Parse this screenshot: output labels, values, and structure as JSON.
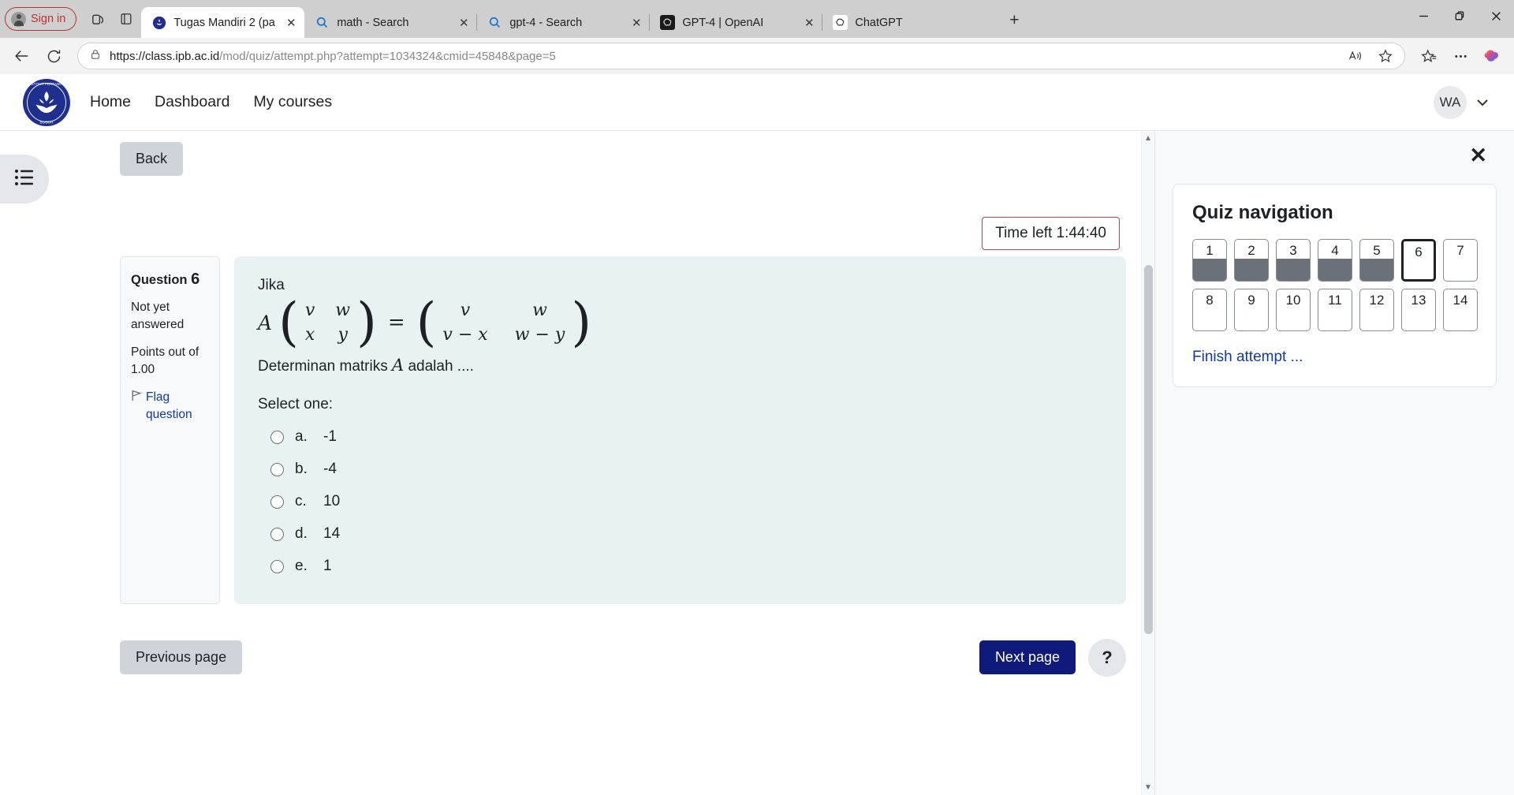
{
  "browser": {
    "signin_label": "Sign in",
    "tabs": [
      {
        "title": "Tugas Mandiri 2 (page",
        "favicon": "ipb-icon",
        "active": true,
        "closable": true
      },
      {
        "title": "math - Search",
        "favicon": "bing-search-icon",
        "active": false,
        "closable": true
      },
      {
        "title": "gpt-4 - Search",
        "favicon": "bing-search-icon",
        "active": false,
        "closable": true
      },
      {
        "title": "GPT-4 | OpenAI",
        "favicon": "openai-dark-icon",
        "active": false,
        "closable": true
      },
      {
        "title": "ChatGPT",
        "favicon": "openai-light-icon",
        "active": false,
        "closable": false
      }
    ],
    "new_tab_label": "+",
    "window_controls": {
      "minimize": "─",
      "restore": "❐",
      "close": "✕"
    },
    "url": "https://class.ipb.ac.id/mod/quiz/attempt.php?attempt=1034324&cmid=45848&page=5",
    "url_host": "https://class.ipb.ac.id",
    "url_path": "/mod/quiz/attempt.php?attempt=1034324&cmid=45848&page=5"
  },
  "site_header": {
    "nav": [
      {
        "label": "Home"
      },
      {
        "label": "Dashboard"
      },
      {
        "label": "My courses"
      }
    ],
    "user_initials": "WA"
  },
  "page": {
    "back_button": "Back",
    "timer_label": "Time left 1:44:40",
    "timer_border_color": "#c4463a"
  },
  "question": {
    "number_label": "Question",
    "number": "6",
    "state": "Not yet answered",
    "points": "Points out of 1.00",
    "flag_label": "Flag question",
    "intro": "Jika",
    "matrix": {
      "coefficient": "A",
      "equals": "=",
      "left": [
        [
          "v",
          "w"
        ],
        [
          "x",
          "y"
        ]
      ],
      "right": [
        [
          "v",
          "w"
        ],
        [
          "v − x",
          "w − y"
        ]
      ]
    },
    "tail_prefix": "Determinan matriks ",
    "tail_var": "A",
    "tail_suffix": " adalah ....",
    "select_label": "Select one:",
    "options": [
      {
        "letter": "a.",
        "text": "-1",
        "selected": false
      },
      {
        "letter": "b.",
        "text": "-4",
        "selected": false
      },
      {
        "letter": "c.",
        "text": "10",
        "selected": false
      },
      {
        "letter": "d.",
        "text": "14",
        "selected": false
      },
      {
        "letter": "e.",
        "text": "1",
        "selected": false
      }
    ]
  },
  "footer_nav": {
    "previous_label": "Previous page",
    "next_label": "Next page",
    "help_label": "?"
  },
  "quiz_nav": {
    "title": "Quiz navigation",
    "close_label": "✕",
    "finish_label": "Finish attempt ...",
    "questions": [
      {
        "n": "1",
        "state": "answered"
      },
      {
        "n": "2",
        "state": "answered"
      },
      {
        "n": "3",
        "state": "answered"
      },
      {
        "n": "4",
        "state": "answered"
      },
      {
        "n": "5",
        "state": "answered"
      },
      {
        "n": "6",
        "state": "current"
      },
      {
        "n": "7",
        "state": "notyet"
      },
      {
        "n": "8",
        "state": "notyet"
      },
      {
        "n": "9",
        "state": "notyet"
      },
      {
        "n": "10",
        "state": "notyet"
      },
      {
        "n": "11",
        "state": "notyet"
      },
      {
        "n": "12",
        "state": "notyet"
      },
      {
        "n": "13",
        "state": "notyet"
      },
      {
        "n": "14",
        "state": "notyet"
      }
    ]
  },
  "colors": {
    "question_bg": "#e8f2f2",
    "primary_button": "#0f1a7a",
    "link": "#0f3a9e",
    "answered_fill": "#6a7178"
  }
}
